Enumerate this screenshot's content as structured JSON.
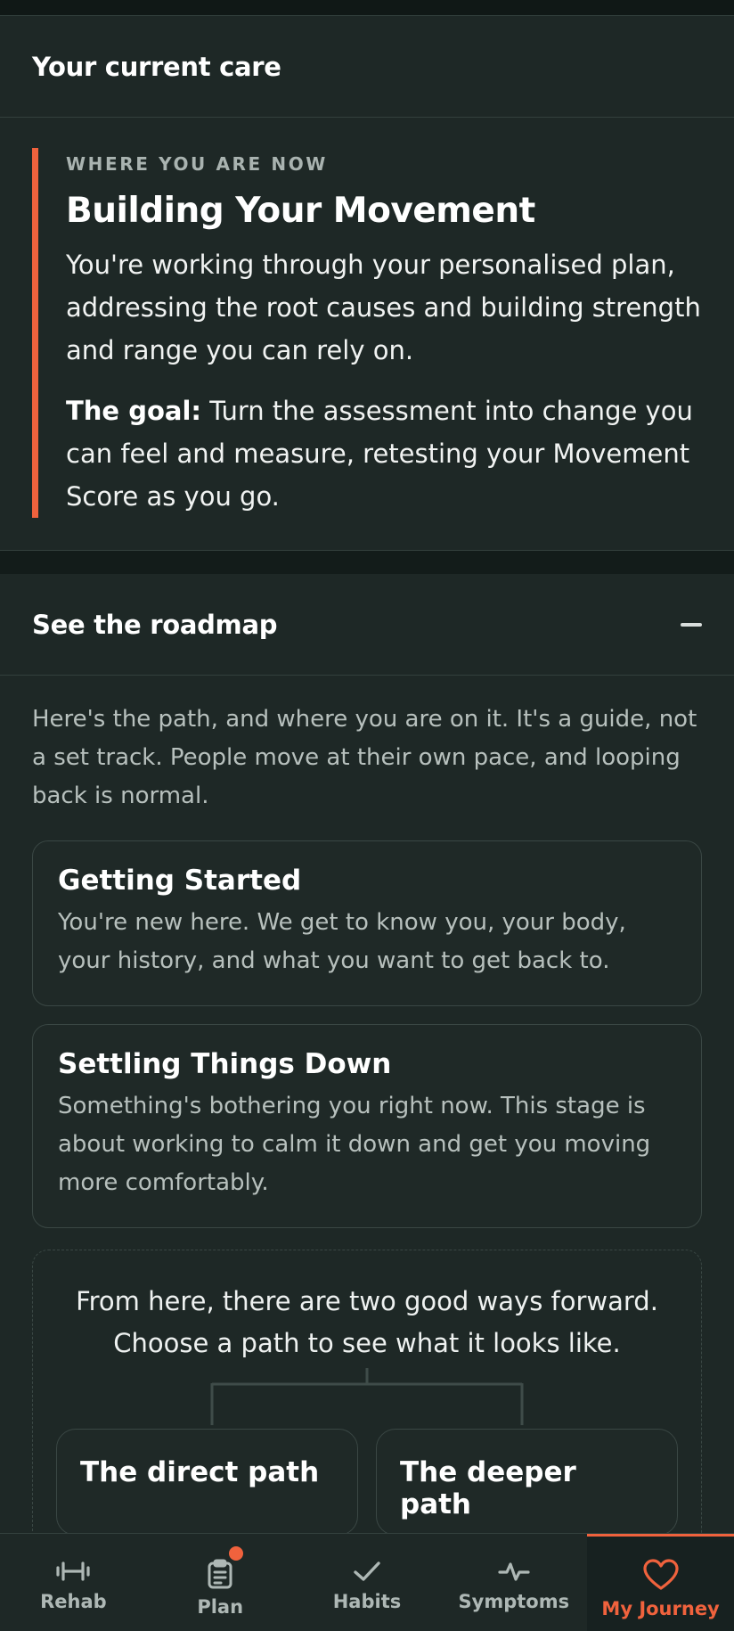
{
  "current_care": {
    "header": "Your current care",
    "eyebrow": "WHERE YOU ARE NOW",
    "stage_title": "Building Your Movement",
    "description": "You're working through your personalised plan, addressing the root causes and building strength and range you can rely on.",
    "goal_label": "The goal:",
    "goal_text": " Turn the assessment into change you can feel and measure, retesting your Movement Score as you go.",
    "accent_color": "#f0623d"
  },
  "roadmap": {
    "header": "See the roadmap",
    "toggle_icon": "minus-icon",
    "intro": "Here's the path, and where you are on it. It's a guide, not a set track. People move at their own pace, and looping back is normal.",
    "stages": [
      {
        "title": "Getting Started",
        "description": "You're new here. We get to know you, your body, your history, and what you want to get back to."
      },
      {
        "title": "Settling Things Down",
        "description": "Something's bothering you right now. This stage is about working to calm it down and get you moving more comfortably."
      }
    ],
    "branch_text": "From here, there are two good ways forward. Choose a path to see what it looks like.",
    "paths": [
      {
        "title": "The direct path"
      },
      {
        "title": "The deeper path"
      }
    ]
  },
  "tabbar": {
    "tabs": [
      {
        "label": "Rehab",
        "icon": "dumbbell-icon"
      },
      {
        "label": "Plan",
        "icon": "clipboard-icon",
        "badge": true
      },
      {
        "label": "Habits",
        "icon": "check-icon"
      },
      {
        "label": "Symptoms",
        "icon": "pulse-icon"
      },
      {
        "label": "My Journey",
        "icon": "heart-icon",
        "active": true
      }
    ]
  }
}
